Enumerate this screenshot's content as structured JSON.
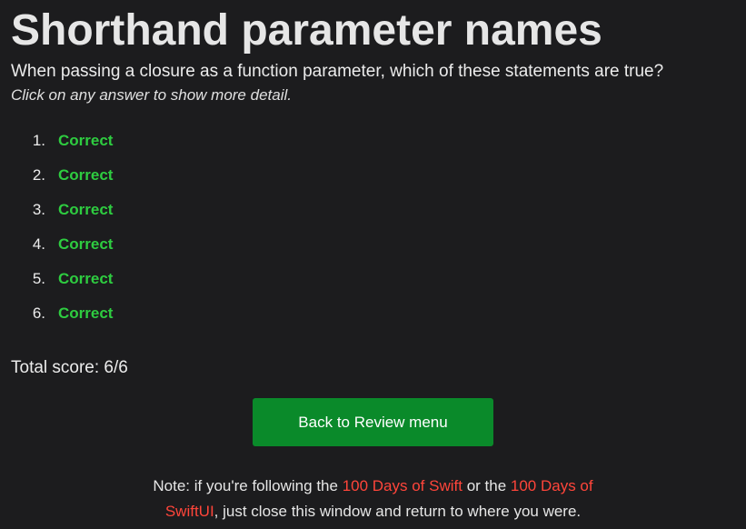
{
  "page": {
    "title": "Shorthand parameter names",
    "question": "When passing a closure as a function parameter, which of these statements are true?",
    "hint": "Click on any answer to show more detail."
  },
  "answers": [
    {
      "number": "1.",
      "status": "Correct"
    },
    {
      "number": "2.",
      "status": "Correct"
    },
    {
      "number": "3.",
      "status": "Correct"
    },
    {
      "number": "4.",
      "status": "Correct"
    },
    {
      "number": "5.",
      "status": "Correct"
    },
    {
      "number": "6.",
      "status": "Correct"
    }
  ],
  "score": {
    "text": "Total score: 6/6"
  },
  "back_button": {
    "label": "Back to Review menu"
  },
  "note": {
    "prefix": "Note: if you're following the ",
    "link1": "100 Days of Swift",
    "middle": " or the ",
    "link2": "100 Days of SwiftUI",
    "suffix": ", just close this window and return to where you were."
  },
  "colors": {
    "background": "#1c1c1e",
    "correct": "#2ecc40",
    "button": "#0a8a2a",
    "link": "#ff453a"
  }
}
